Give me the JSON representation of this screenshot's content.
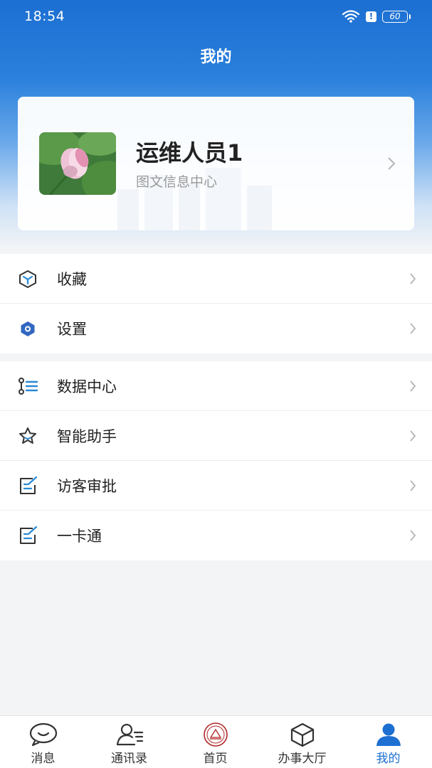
{
  "status_bar": {
    "time": "18:54",
    "battery": "60",
    "alert": "!",
    "icons": [
      "wifi-icon",
      "alert-icon",
      "battery-icon"
    ]
  },
  "header": {
    "title": "我的"
  },
  "profile": {
    "name": "运维人员1",
    "department": "图文信息中心",
    "avatar": "lotus-avatar-image"
  },
  "menu_groups": [
    {
      "items": [
        {
          "label": "收藏",
          "icon": "cube-icon"
        },
        {
          "label": "设置",
          "icon": "hexagon-settings-icon"
        }
      ]
    },
    {
      "items": [
        {
          "label": "数据中心",
          "icon": "data-list-icon"
        },
        {
          "label": "智能助手",
          "icon": "star-icon"
        },
        {
          "label": "访客审批",
          "icon": "edit-note-icon"
        },
        {
          "label": "一卡通",
          "icon": "edit-note-icon"
        }
      ]
    }
  ],
  "tabbar": {
    "active": "我的",
    "tabs": [
      {
        "label": "消息",
        "icon": "chat-bubble-icon"
      },
      {
        "label": "通讯录",
        "icon": "contacts-icon"
      },
      {
        "label": "首页",
        "icon": "school-emblem-icon"
      },
      {
        "label": "办事大厅",
        "icon": "box-icon"
      },
      {
        "label": "我的",
        "icon": "person-icon"
      }
    ]
  },
  "colors": {
    "primary": "#1d6fd2",
    "accent_icon": "#2a7fd6",
    "text": "#222222",
    "subtext": "#9a9a9a",
    "background": "#f3f4f6"
  }
}
